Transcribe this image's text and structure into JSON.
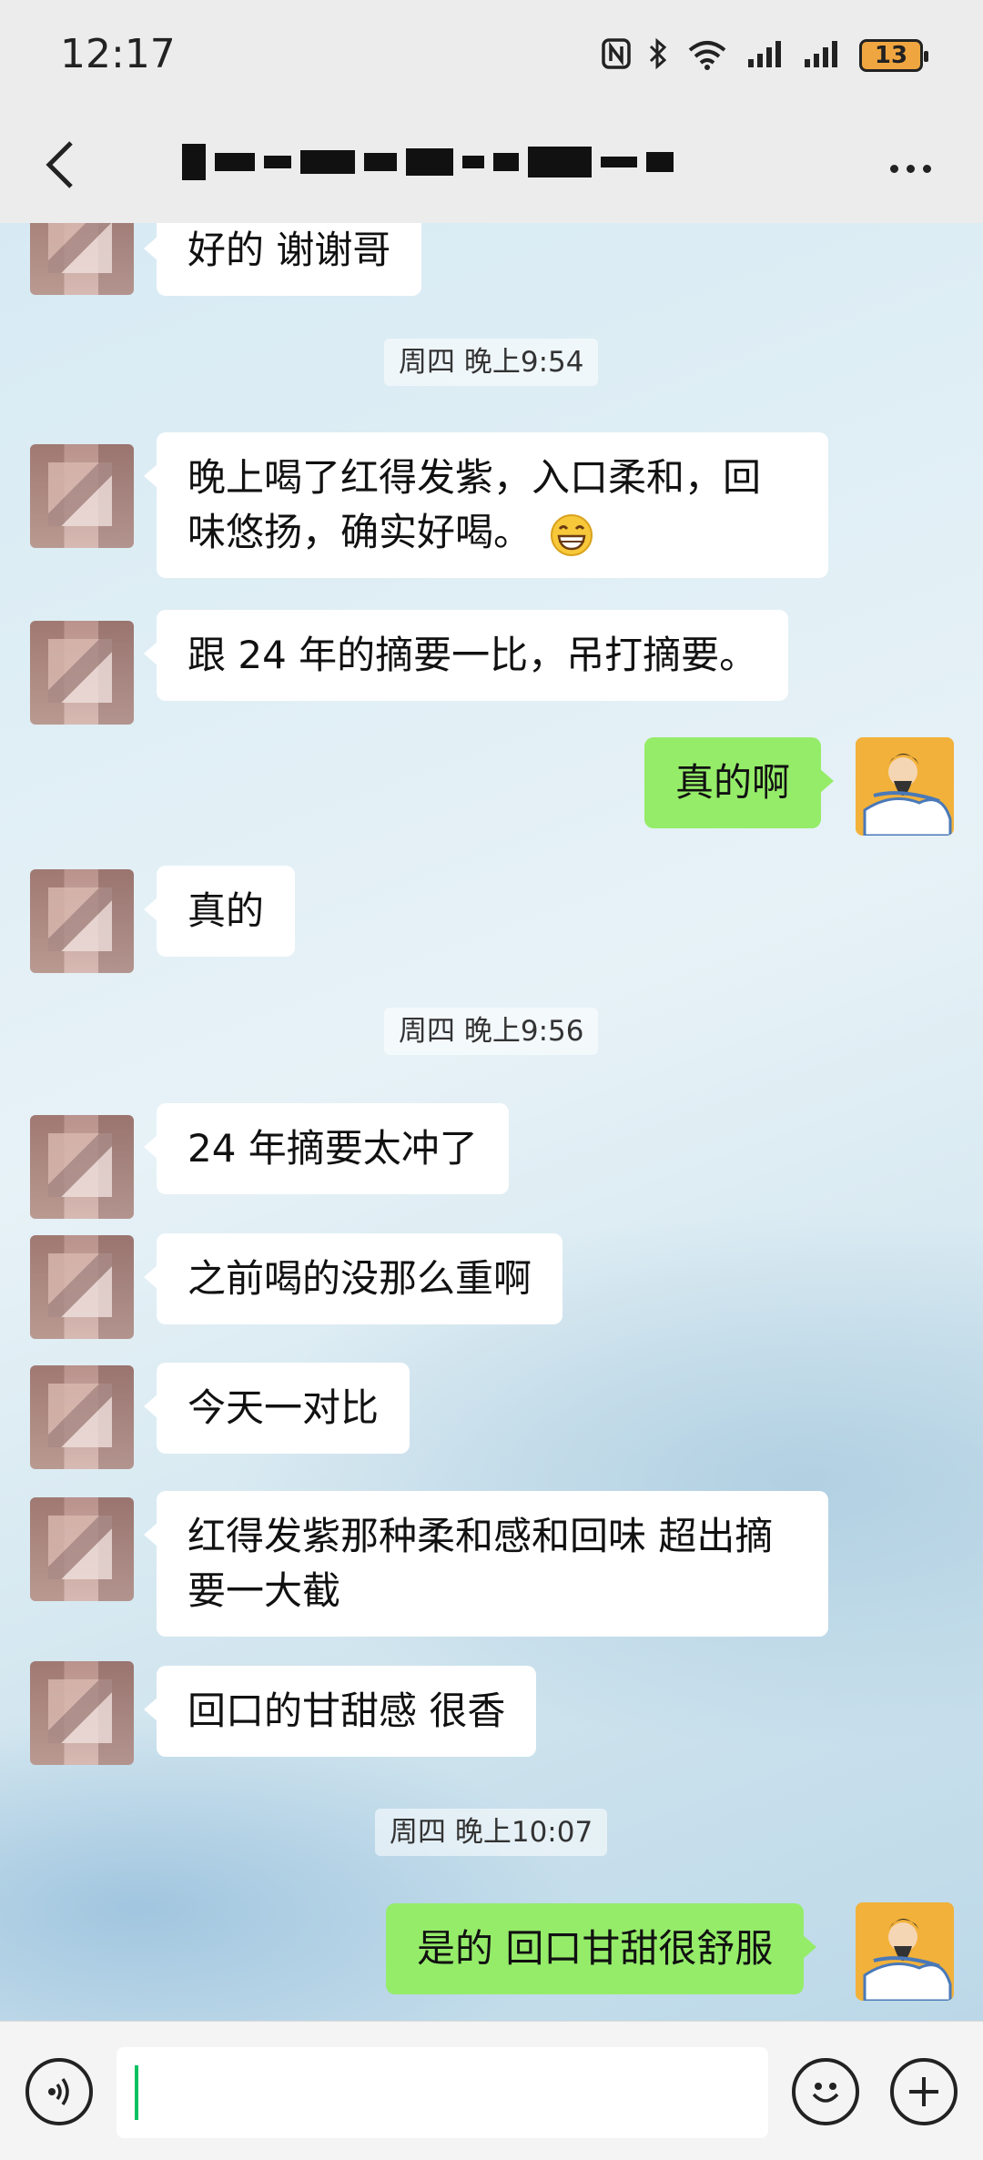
{
  "status_bar": {
    "time": "12:17",
    "battery": "13",
    "icons": [
      "nfc-icon",
      "bluetooth-icon",
      "wifi-6-icon",
      "signal-icon",
      "signal-icon",
      "battery-icon"
    ]
  },
  "header": {
    "title": "",
    "back_icon": "chevron-left-icon",
    "more_icon": "more-horizontal-icon"
  },
  "messages": [
    {
      "from": "other",
      "text": "好的 谢谢哥"
    },
    {
      "type": "timestamp",
      "text": "周四 晚上9:54"
    },
    {
      "from": "other",
      "lines": [
        "晚上喝了红得发紫，入口柔和，回",
        "味悠扬，确实好喝。"
      ],
      "emoji": "grin-emoji"
    },
    {
      "from": "other",
      "text": "跟 24 年的摘要一比，吊打摘要。"
    },
    {
      "from": "me",
      "text": "真的啊"
    },
    {
      "from": "other",
      "text": "真的"
    },
    {
      "type": "timestamp",
      "text": "周四 晚上9:56"
    },
    {
      "from": "other",
      "text": "24 年摘要太冲了"
    },
    {
      "from": "other",
      "text": "之前喝的没那么重啊"
    },
    {
      "from": "other",
      "text": "今天一对比"
    },
    {
      "from": "other",
      "lines": [
        "红得发紫那种柔和感和回味 超出摘",
        "要一大截"
      ]
    },
    {
      "from": "other",
      "text": "回口的甘甜感 很香"
    },
    {
      "type": "timestamp",
      "text": "周四 晚上10:07"
    },
    {
      "from": "me",
      "text": "是的 回口甘甜很舒服"
    }
  ],
  "input_bar": {
    "value": "",
    "voice_icon": "voice-icon",
    "emoji_icon": "emoji-icon",
    "plus_icon": "plus-icon",
    "caret_color": "#07c160"
  },
  "colors": {
    "my_bubble": "#95ec69",
    "other_bubble": "#ffffff",
    "battery": "#f0a640"
  }
}
